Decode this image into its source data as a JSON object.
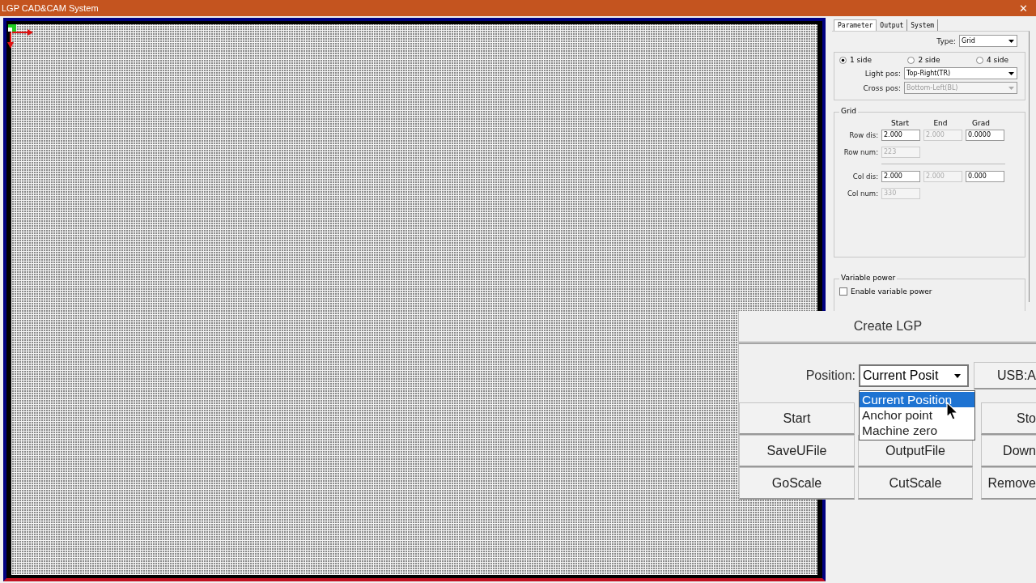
{
  "window": {
    "title": "LGP CAD&CAM System",
    "close": "✕"
  },
  "tabs": [
    {
      "label": "Parameter",
      "selected": true
    },
    {
      "label": "Output",
      "selected": false
    },
    {
      "label": "System",
      "selected": false
    }
  ],
  "type": {
    "label": "Type:",
    "value": "Grid"
  },
  "sides": [
    {
      "label": "1 side",
      "selected": true
    },
    {
      "label": "2 side",
      "selected": false
    },
    {
      "label": "4 side",
      "selected": false
    }
  ],
  "light_pos": {
    "label": "Light pos:",
    "value": "Top-Right(TR)",
    "disabled": false
  },
  "cross_pos": {
    "label": "Cross pos:",
    "value": "Bottom-Left(BL)",
    "disabled": true
  },
  "grid": {
    "title": "Grid",
    "headers": [
      "Start",
      "End",
      "Grad"
    ],
    "rows": [
      {
        "label": "Row dis:",
        "fields": [
          {
            "value": "2.000",
            "disabled": false
          },
          {
            "value": "2.000",
            "disabled": true
          },
          {
            "value": "0.0000",
            "disabled": false
          }
        ]
      },
      {
        "label": "Row num:",
        "fields": [
          {
            "value": "223",
            "disabled": true
          }
        ]
      },
      {
        "label": "Col dis:",
        "fields": [
          {
            "value": "2.000",
            "disabled": false
          },
          {
            "value": "2.000",
            "disabled": true
          },
          {
            "value": "0.000",
            "disabled": false
          }
        ]
      },
      {
        "label": "Col num:",
        "fields": [
          {
            "value": "330",
            "disabled": true
          }
        ]
      }
    ]
  },
  "variable_power": {
    "title": "Variable power",
    "label": "Enable variable power",
    "checked": false
  },
  "dialog": {
    "title": "Create LGP",
    "position_label": "Position:",
    "position_value": "Current Posit",
    "usb": "USB:A",
    "options": [
      {
        "label": "Current Position",
        "selected": true
      },
      {
        "label": "Anchor point",
        "selected": false
      },
      {
        "label": "Machine zero",
        "selected": false
      }
    ],
    "button_rows": [
      {
        "left": "Start",
        "right": "Sto"
      },
      {
        "left": "SaveUFile",
        "middle": "OutputFile",
        "right": "Down"
      },
      {
        "left": "GoScale",
        "middle": "CutScale",
        "right": "Remove"
      }
    ]
  }
}
